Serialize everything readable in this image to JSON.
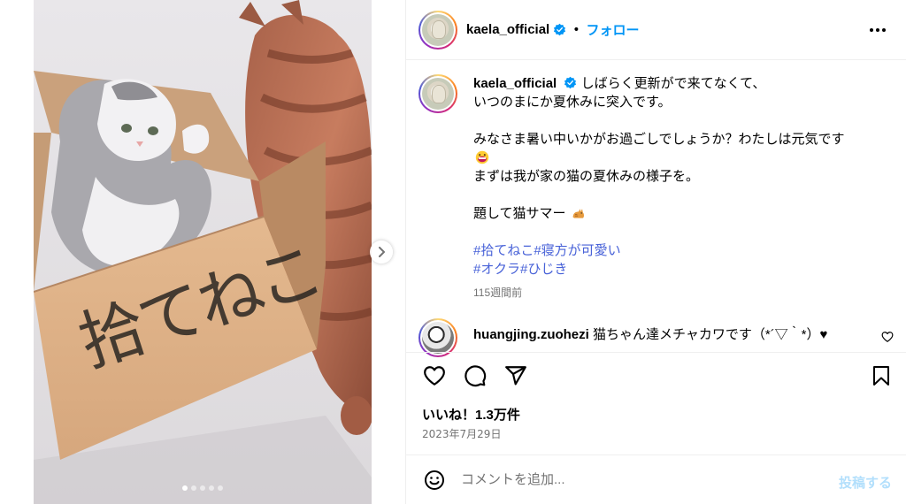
{
  "post": {
    "media": {
      "box_text": "拾てねこ",
      "carousel_dots": 5,
      "active_dot": 1
    },
    "header": {
      "username": "kaela_official",
      "verified": true,
      "separator": "•",
      "follow_label": "フォロー"
    },
    "caption": {
      "username": "kaela_official",
      "line1": "しばらく更新がで来てなくて、",
      "line2": "いつのまにか夏休みに突入です。",
      "line3": "みなさま暑い中いかがお過ごしでしょうか？わたしは元気です",
      "line4": "まずは我が家の猫の夏休みの様子を。",
      "line5": "題して猫サマー",
      "hashtags_line1": "#拾てねこ#寝方が可愛い",
      "hashtags_line2": "#オクラ#ひじき",
      "time_ago": "115週間前"
    },
    "comment": {
      "username": "huangjing.zuohezi",
      "text": "猫ちゃん達メチャカワです（*´▽｀*）♥"
    },
    "likes": "いいね！1.3万件",
    "date": "2023年7月29日",
    "comment_box": {
      "placeholder": "コメントを追加...",
      "post_label": "投稿する"
    },
    "colors": {
      "accent": "#0095f6",
      "hashtag": "#4862d8",
      "muted": "#737373",
      "post_disabled": "#b2dffc"
    },
    "icons": [
      "verified-badge-icon",
      "more-options-icon",
      "next-arrow-icon",
      "heart-icon",
      "comment-icon",
      "share-icon",
      "bookmark-icon",
      "emoji-icon",
      "grinning-emoji-icon",
      "cat-emoji-icon"
    ]
  }
}
